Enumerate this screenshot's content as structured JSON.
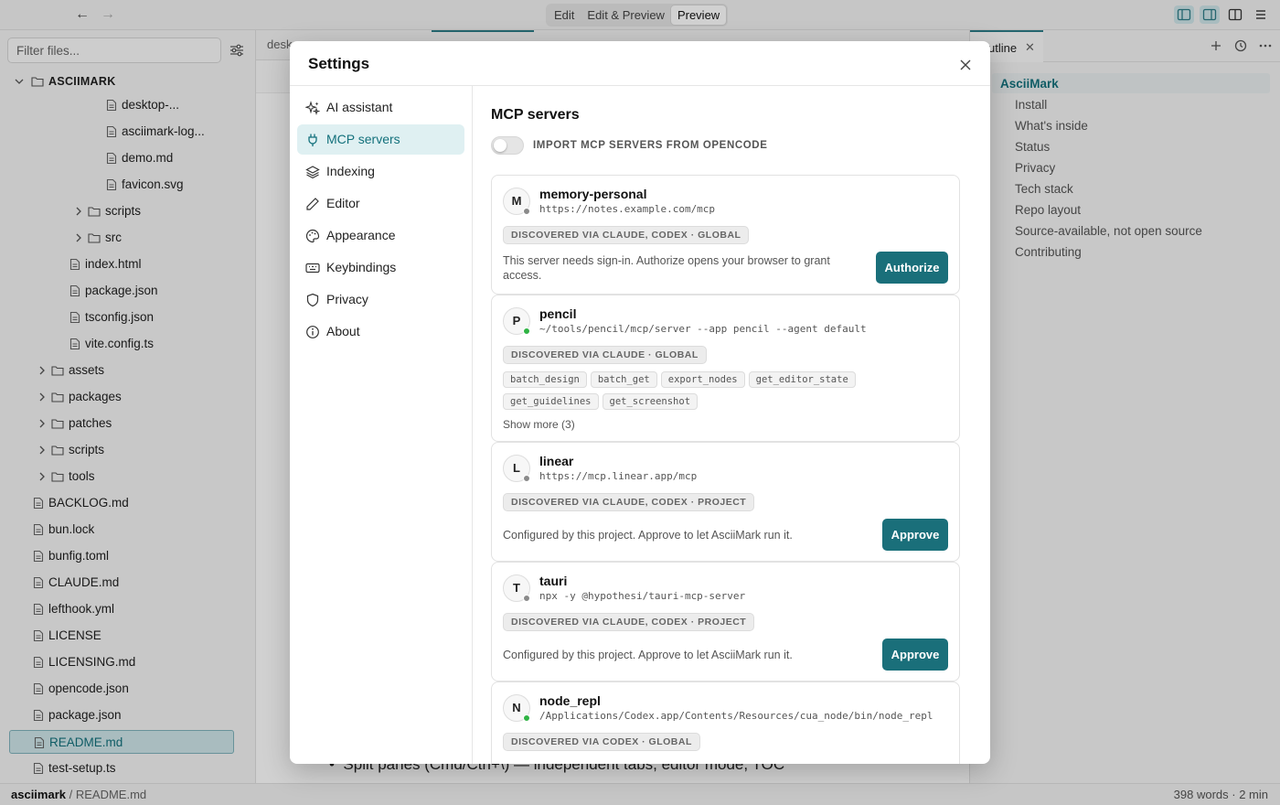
{
  "topbar": {
    "modes": [
      {
        "label": "Edit",
        "active": false
      },
      {
        "label": "Edit & Preview",
        "active": false
      },
      {
        "label": "Preview",
        "active": true
      }
    ]
  },
  "sidebar": {
    "filter_placeholder": "Filter files...",
    "root_label": "ASCIIMARK",
    "items": [
      {
        "label": "desktop-...",
        "type": "file"
      },
      {
        "label": "asciimark-log...",
        "type": "file"
      },
      {
        "label": "demo.md",
        "type": "file"
      },
      {
        "label": "favicon.svg",
        "type": "file"
      },
      {
        "label": "scripts",
        "type": "folder"
      },
      {
        "label": "src",
        "type": "folder"
      },
      {
        "label": "index.html",
        "type": "file"
      },
      {
        "label": "package.json",
        "type": "file"
      },
      {
        "label": "tsconfig.json",
        "type": "file"
      },
      {
        "label": "vite.config.ts",
        "type": "file"
      },
      {
        "label": "assets",
        "type": "folder"
      },
      {
        "label": "packages",
        "type": "folder"
      },
      {
        "label": "patches",
        "type": "folder"
      },
      {
        "label": "scripts",
        "type": "folder"
      },
      {
        "label": "tools",
        "type": "folder"
      },
      {
        "label": "BACKLOG.md",
        "type": "file"
      },
      {
        "label": "bun.lock",
        "type": "file"
      },
      {
        "label": "bunfig.toml",
        "type": "file"
      },
      {
        "label": "CLAUDE.md",
        "type": "file"
      },
      {
        "label": "lefthook.yml",
        "type": "file"
      },
      {
        "label": "LICENSE",
        "type": "file"
      },
      {
        "label": "LICENSING.md",
        "type": "file"
      },
      {
        "label": "opencode.json",
        "type": "file"
      },
      {
        "label": "package.json",
        "type": "file"
      },
      {
        "label": "README.md",
        "type": "file",
        "selected": true
      },
      {
        "label": "test-setup.ts",
        "type": "file"
      }
    ]
  },
  "editor": {
    "tab_label": "desk",
    "bullet_text": "Split panes (Cmd/Ctrl+\\) — independent tabs, editor mode, TOC"
  },
  "outline": {
    "tab_label": "utline",
    "items": [
      {
        "label": "AsciiMark",
        "level": 1
      },
      {
        "label": "Install",
        "level": 2
      },
      {
        "label": "What's inside",
        "level": 2
      },
      {
        "label": "Status",
        "level": 2
      },
      {
        "label": "Privacy",
        "level": 2
      },
      {
        "label": "Tech stack",
        "level": 2
      },
      {
        "label": "Repo layout",
        "level": 2
      },
      {
        "label": "Source-available, not open source",
        "level": 2
      },
      {
        "label": "Contributing",
        "level": 2
      }
    ]
  },
  "statusbar": {
    "project": "asciimark",
    "path": " / README.md",
    "stats": "398 words · 2 min"
  },
  "settings": {
    "title": "Settings",
    "nav": [
      {
        "label": "AI assistant",
        "icon": "sparkles-icon",
        "active": false
      },
      {
        "label": "MCP servers",
        "icon": "plug-icon",
        "active": true
      },
      {
        "label": "Indexing",
        "icon": "layers-icon",
        "active": false
      },
      {
        "label": "Editor",
        "icon": "pen-icon",
        "active": false
      },
      {
        "label": "Appearance",
        "icon": "palette-icon",
        "active": false
      },
      {
        "label": "Keybindings",
        "icon": "keyboard-icon",
        "active": false
      },
      {
        "label": "Privacy",
        "icon": "shield-icon",
        "active": false
      },
      {
        "label": "About",
        "icon": "info-icon",
        "active": false
      }
    ],
    "mcp": {
      "section_title": "MCP servers",
      "import_toggle_label": "IMPORT MCP SERVERS FROM OPENCODE",
      "import_toggle_on": false,
      "servers": [
        {
          "initial": "M",
          "name": "memory-personal",
          "command": "https://notes.example.com/mcp",
          "status_color": "#8a8a8a",
          "badge": "DISCOVERED VIA CLAUDE, CODEX · GLOBAL",
          "note": "This server needs sign-in. Authorize opens your browser to grant access.",
          "action": "Authorize"
        },
        {
          "initial": "P",
          "name": "pencil",
          "command": "~/tools/pencil/mcp/server --app pencil --agent default",
          "status_color": "#2fb344",
          "badge": "DISCOVERED VIA CLAUDE · GLOBAL",
          "tools": [
            "batch_design",
            "batch_get",
            "export_nodes",
            "get_editor_state",
            "get_guidelines",
            "get_screenshot"
          ],
          "show_more": "Show more (3)"
        },
        {
          "initial": "L",
          "name": "linear",
          "command": "https://mcp.linear.app/mcp",
          "status_color": "#8a8a8a",
          "badge": "DISCOVERED VIA CLAUDE, CODEX · PROJECT",
          "note": "Configured by this project. Approve to let AsciiMark run it.",
          "action": "Approve"
        },
        {
          "initial": "T",
          "name": "tauri",
          "command": "npx -y @hypothesi/tauri-mcp-server",
          "status_color": "#8a8a8a",
          "badge": "DISCOVERED VIA CLAUDE, CODEX · PROJECT",
          "note": "Configured by this project. Approve to let AsciiMark run it.",
          "action": "Approve"
        },
        {
          "initial": "N",
          "name": "node_repl",
          "command": "/Applications/Codex.app/Contents/Resources/cua_node/bin/node_repl",
          "status_color": "#2fb344",
          "badge": "DISCOVERED VIA CODEX · GLOBAL"
        }
      ]
    }
  }
}
